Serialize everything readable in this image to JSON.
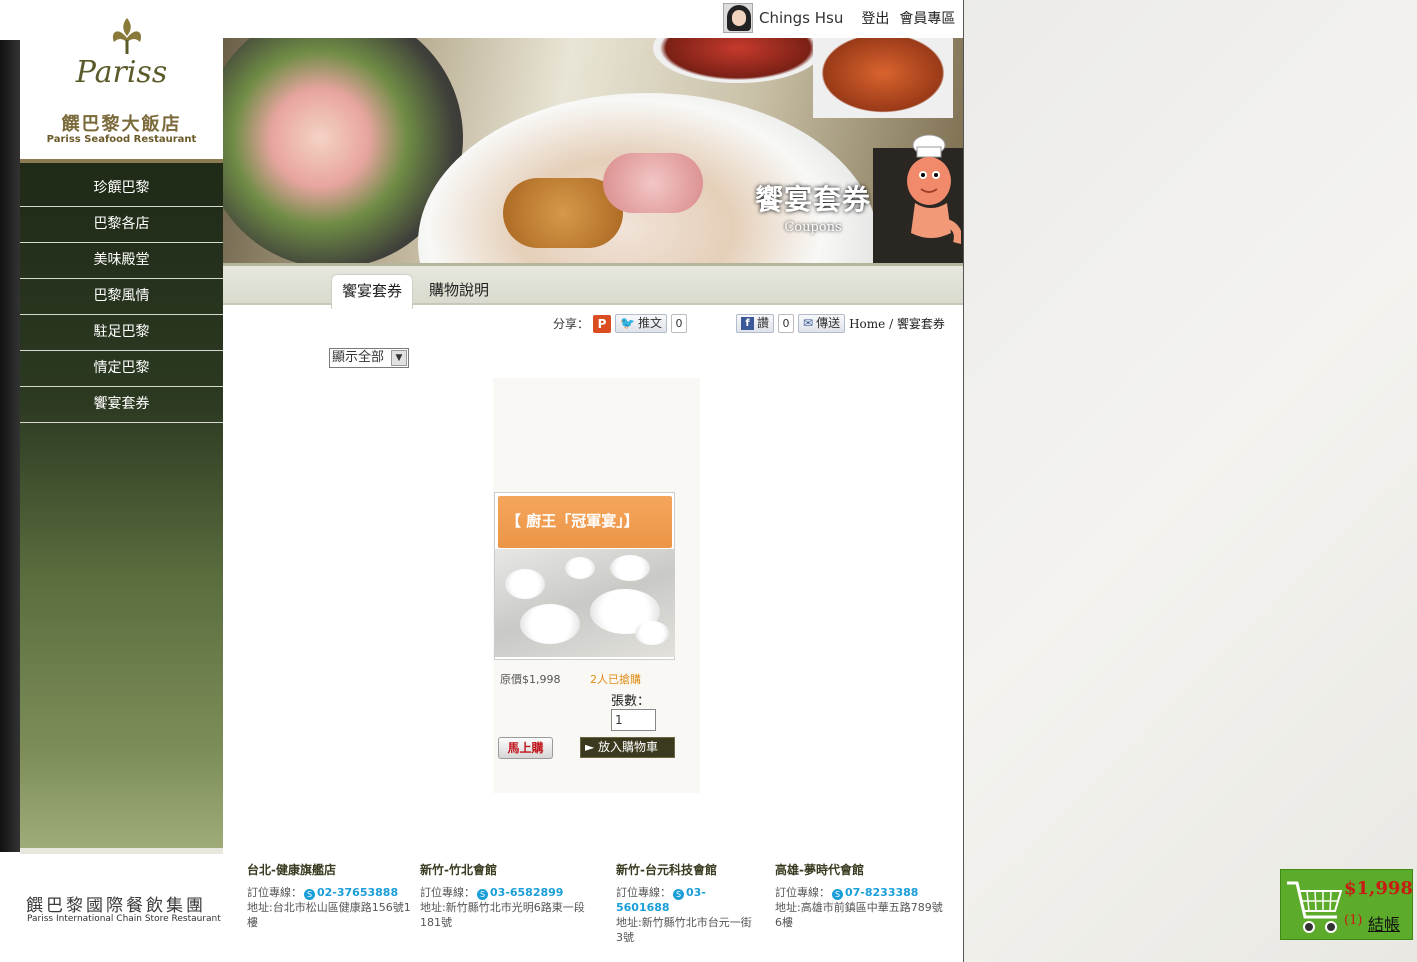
{
  "user": {
    "name": "Chings Hsu",
    "logout_label": "登出",
    "member_label": "會員專區"
  },
  "logo": {
    "word": "Pariss",
    "name_cn": "饌巴黎大飯店",
    "name_en": "Pariss Seafood Restaurant"
  },
  "sidebar": {
    "items": [
      {
        "label": "珍饌巴黎"
      },
      {
        "label": "巴黎各店"
      },
      {
        "label": "美味殿堂"
      },
      {
        "label": "巴黎風情"
      },
      {
        "label": "駐足巴黎"
      },
      {
        "label": "情定巴黎"
      },
      {
        "label": "饗宴套券"
      }
    ]
  },
  "banner": {
    "title": "饗宴套券",
    "subtitle": "Coupons"
  },
  "tabs": [
    {
      "label": "饗宴套券",
      "active": true
    },
    {
      "label": "購物說明",
      "active": false
    }
  ],
  "share": {
    "label": "分享：",
    "plurk_icon": "P",
    "tweet_label": "推文",
    "tweet_count": "0",
    "fb_like_label": "讚",
    "fb_like_count": "0",
    "send_label": "傳送"
  },
  "breadcrumb": "Home / 饗宴套券",
  "filter": {
    "selected": "顯示全部"
  },
  "product": {
    "title": "【 廚王「冠軍宴」】",
    "original_price": "原價$1,998",
    "sold": "2人已搶購",
    "qty_label": "張數：",
    "qty_value": "1",
    "buy_now_label": "馬上購",
    "add_cart_label": "► 放入購物車"
  },
  "footer": {
    "group_cn": "饌巴黎國際餐飲集團",
    "group_en": "Pariss International Chain Store Restaurant",
    "stores": [
      {
        "name": "台北-健康旗艦店",
        "tel_label": "訂位專線：",
        "tel": "02-37653888",
        "address": "地址:台北市松山區健康路156號1樓"
      },
      {
        "name": "新竹-竹北會館",
        "tel_label": "訂位專線：",
        "tel": "03-6582899",
        "address": "地址:新竹縣竹北市光明6路東一段181號"
      },
      {
        "name": "新竹-台元科技會館",
        "tel_label": "訂位專線：",
        "tel": "03-5601688",
        "address": "地址:新竹縣竹北市台元一街3號"
      },
      {
        "name": "高雄-夢時代會館",
        "tel_label": "訂位專線：",
        "tel": "07-8233388",
        "address": "地址:高雄市前鎮區中華五路789號6樓"
      }
    ]
  },
  "cart": {
    "total": "$1,998",
    "count": "(1)",
    "checkout_label": "結帳"
  },
  "colors": {
    "sidebar_dark": "#2d3a22",
    "card_orange": "#ec9547",
    "cart_green": "#5cab2a",
    "price_red": "#c81b12",
    "tel_blue": "#1a9ed8"
  }
}
